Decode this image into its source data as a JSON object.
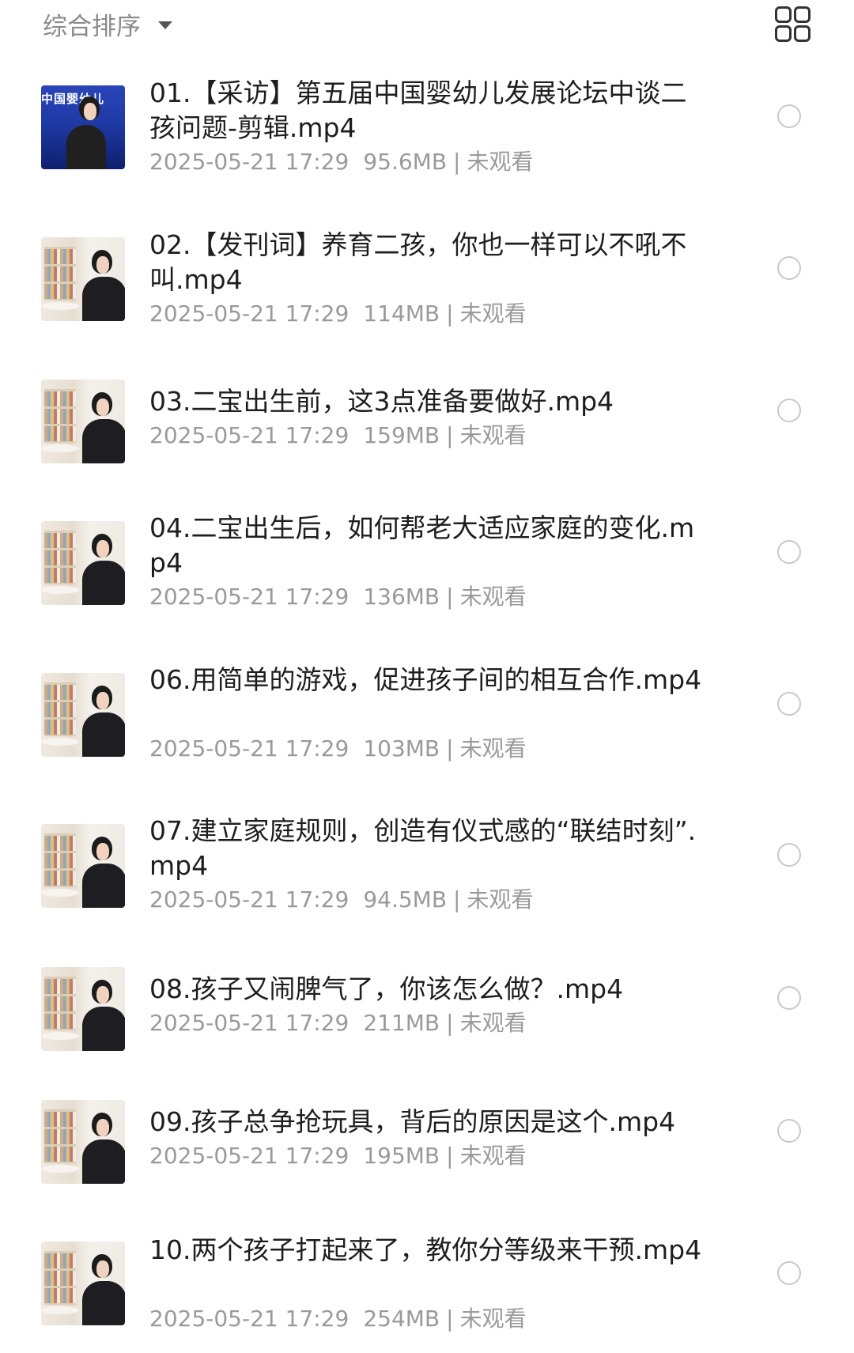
{
  "toolbar": {
    "sort_label": "综合排序",
    "view_toggle_icon": "grid-view-icon"
  },
  "thumbnail_banner": "中国婴幼儿",
  "files": [
    {
      "title": "01.【采访】第五届中国婴幼儿发展论坛中谈二孩问题-剪辑.mp4",
      "date": "2025-05-21 17:29",
      "size": "95.6MB",
      "status": "未观看"
    },
    {
      "title": "02.【发刊词】养育二孩，你也一样可以不吼不叫.mp4",
      "date": "2025-05-21 17:29",
      "size": "114MB",
      "status": "未观看"
    },
    {
      "title": "03.二宝出生前，这3点准备要做好.mp4",
      "date": "2025-05-21 17:29",
      "size": "159MB",
      "status": "未观看"
    },
    {
      "title": "04.二宝出生后，如何帮老大适应家庭的变化.mp4",
      "date": "2025-05-21 17:29",
      "size": "136MB",
      "status": "未观看"
    },
    {
      "title": "06.用简单的游戏，促进孩子间的相互合作.mp4",
      "date": "2025-05-21 17:29",
      "size": "103MB",
      "status": "未观看"
    },
    {
      "title": "07.建立家庭规则，创造有仪式感的“联结时刻”.mp4",
      "date": "2025-05-21 17:29",
      "size": "94.5MB",
      "status": "未观看"
    },
    {
      "title": "08.孩子又闹脾气了，你该怎么做？.mp4",
      "date": "2025-05-21 17:29",
      "size": "211MB",
      "status": "未观看"
    },
    {
      "title": "09.孩子总争抢玩具，背后的原因是这个.mp4",
      "date": "2025-05-21 17:29",
      "size": "195MB",
      "status": "未观看"
    },
    {
      "title": "10.两个孩子打起来了，教你分等级来干预.mp4",
      "date": "2025-05-21 17:29",
      "size": "254MB",
      "status": "未观看"
    }
  ]
}
